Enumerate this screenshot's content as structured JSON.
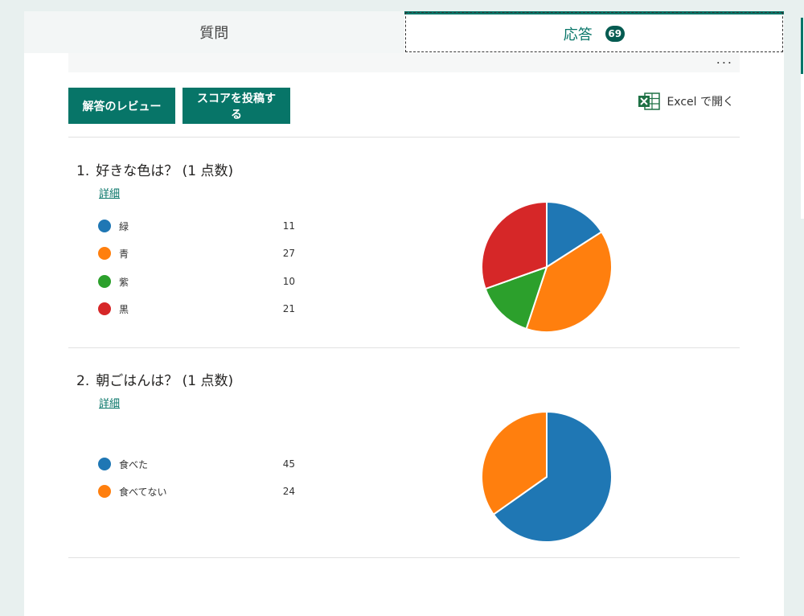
{
  "tabs": [
    {
      "label": "質問",
      "active": false
    },
    {
      "label": "応答",
      "active": true,
      "badge": "69"
    }
  ],
  "toolbar": {
    "more_label": "...",
    "review_label": "解答のレビュー",
    "score_label": "スコアを投稿する",
    "excel_label": "Excel で開く"
  },
  "questions": [
    {
      "number": "1.",
      "title": "好きな色は？ (1 点数)",
      "detail_label": "詳細",
      "items": [
        {
          "label": "緑",
          "count": "11",
          "color": "#1f77b4"
        },
        {
          "label": "青",
          "count": "27",
          "color": "#ff7f0e"
        },
        {
          "label": "紫",
          "count": "10",
          "color": "#2ca02c"
        },
        {
          "label": "黒",
          "count": "21",
          "color": "#d62728"
        }
      ]
    },
    {
      "number": "2.",
      "title": "朝ごはんは？ (1 点数)",
      "detail_label": "詳細",
      "items": [
        {
          "label": "食べた",
          "count": "45",
          "color": "#1f77b4"
        },
        {
          "label": "食べてない",
          "count": "24",
          "color": "#ff7f0e"
        }
      ]
    }
  ],
  "chart_data": [
    {
      "type": "pie",
      "categories": [
        "緑",
        "青",
        "紫",
        "黒"
      ],
      "values": [
        11,
        27,
        10,
        21
      ],
      "colors": [
        "#1f77b4",
        "#ff7f0e",
        "#2ca02c",
        "#d62728"
      ]
    },
    {
      "type": "pie",
      "categories": [
        "食べた",
        "食べてない"
      ],
      "values": [
        45,
        24
      ],
      "colors": [
        "#1f77b4",
        "#ff7f0e"
      ]
    }
  ]
}
